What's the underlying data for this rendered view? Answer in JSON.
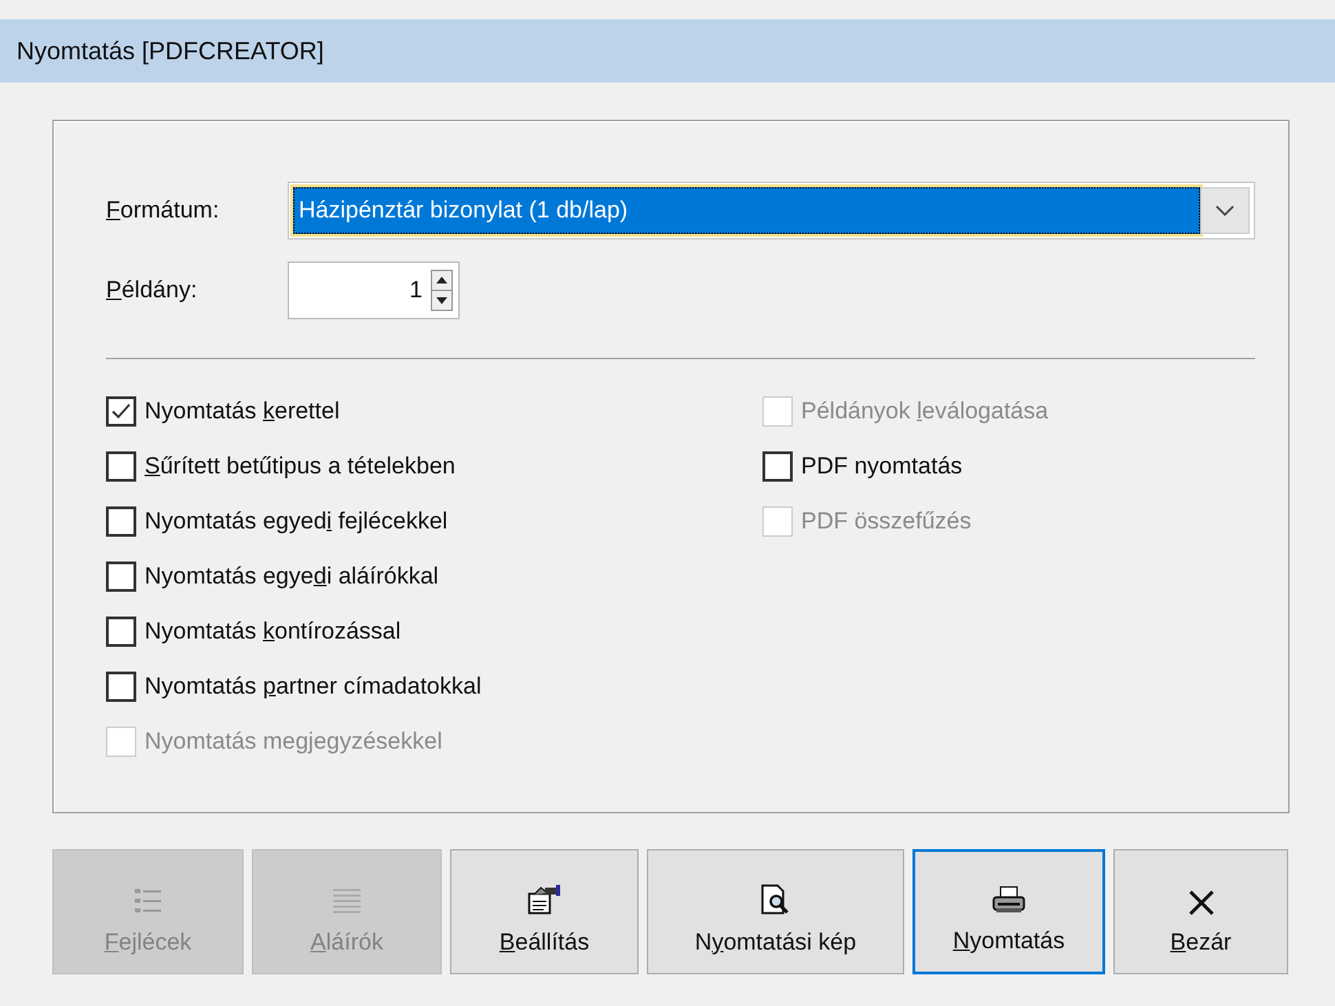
{
  "window": {
    "title": "Nyomtatás [PDFCREATOR]"
  },
  "format": {
    "label": {
      "key": "F",
      "rest": "ormátum:"
    },
    "value": "Házipénztár bizonylat (1 db/lap)",
    "selected": true
  },
  "copies": {
    "label": {
      "key": "P",
      "rest": "éldány:"
    },
    "value": "1"
  },
  "options_left": [
    {
      "label": {
        "text": "Nyomtatás ",
        "key": "k",
        "rest": "erettel"
      },
      "checked": true,
      "disabled": false
    },
    {
      "label": {
        "key": "S",
        "rest": "űrített betűtipus a tételekben"
      },
      "checked": false,
      "disabled": false
    },
    {
      "label": {
        "text": "Nyomtatás egyed",
        "key": "i",
        "rest": " fejlécekkel"
      },
      "checked": false,
      "disabled": false
    },
    {
      "label": {
        "text": "Nyomtatás egye",
        "key": "d",
        "rest": "i aláírókkal"
      },
      "checked": false,
      "disabled": false
    },
    {
      "label": {
        "text": "Nyomtatás ",
        "key": "k",
        "rest": "ontírozással"
      },
      "checked": false,
      "disabled": false
    },
    {
      "label": {
        "text": "Nyomtatás ",
        "key": "p",
        "rest": "artner címadatokkal"
      },
      "checked": false,
      "disabled": false
    },
    {
      "label": {
        "text": "Nyomtatás megjegyzésekkel"
      },
      "checked": false,
      "disabled": true
    }
  ],
  "options_right": [
    {
      "label": {
        "text": "Példányok ",
        "key": "l",
        "rest": "eválogatása"
      },
      "checked": false,
      "disabled": true
    },
    {
      "label": {
        "text": "PDF nyomtatás"
      },
      "checked": false,
      "disabled": false
    },
    {
      "label": {
        "text": "PDF összefűzés"
      },
      "checked": false,
      "disabled": true
    }
  ],
  "buttons": [
    {
      "kind": "headers",
      "label": {
        "key": "F",
        "rest": "ejlécek"
      },
      "disabled": true,
      "selected": false
    },
    {
      "kind": "signers",
      "label": {
        "key": "A",
        "rest": "láírók"
      },
      "disabled": true,
      "selected": false
    },
    {
      "kind": "settings",
      "label": {
        "key": "B",
        "rest": "eállítás"
      },
      "disabled": false,
      "selected": false
    },
    {
      "kind": "preview",
      "label": {
        "text": "N",
        "key": "y",
        "rest": "omtatási kép"
      },
      "disabled": false,
      "selected": false
    },
    {
      "kind": "print",
      "label": {
        "key": "N",
        "rest": "yomtatás"
      },
      "disabled": false,
      "selected": true
    },
    {
      "kind": "close",
      "label": {
        "key": "B",
        "rest": "ezár"
      },
      "disabled": false,
      "selected": false
    }
  ]
}
